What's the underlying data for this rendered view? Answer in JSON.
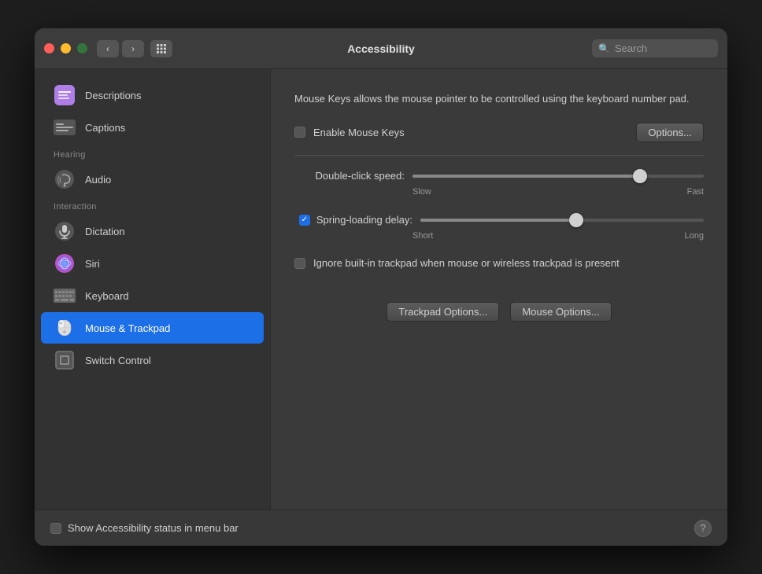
{
  "window": {
    "title": "Accessibility"
  },
  "titlebar": {
    "search_placeholder": "Search",
    "back_icon": "‹",
    "forward_icon": "›",
    "grid_icon": "⊞"
  },
  "sidebar": {
    "items_top": [
      {
        "id": "descriptions",
        "label": "Descriptions",
        "icon": "descriptions"
      },
      {
        "id": "captions",
        "label": "Captions",
        "icon": "captions"
      }
    ],
    "section_hearing": "Hearing",
    "items_hearing": [
      {
        "id": "audio",
        "label": "Audio",
        "icon": "audio"
      }
    ],
    "section_interaction": "Interaction",
    "items_interaction": [
      {
        "id": "dictation",
        "label": "Dictation",
        "icon": "dictation"
      },
      {
        "id": "siri",
        "label": "Siri",
        "icon": "siri"
      },
      {
        "id": "keyboard",
        "label": "Keyboard",
        "icon": "keyboard"
      },
      {
        "id": "mouse-trackpad",
        "label": "Mouse & Trackpad",
        "icon": "mouse",
        "active": true
      },
      {
        "id": "switch-control",
        "label": "Switch Control",
        "icon": "switch"
      }
    ]
  },
  "content": {
    "description": "Mouse Keys allows the mouse pointer to be controlled using the keyboard number pad.",
    "enable_mouse_keys_label": "Enable Mouse Keys",
    "options_button": "Options...",
    "double_click_label": "Double-click speed:",
    "double_click_slow": "Slow",
    "double_click_fast": "Fast",
    "double_click_value": 78,
    "spring_loading_label": "Spring-loading delay:",
    "spring_loading_short": "Short",
    "spring_loading_long": "Long",
    "spring_loading_value": 55,
    "spring_loading_checked": true,
    "ignore_trackpad_label": "Ignore built-in trackpad when mouse or wireless trackpad is present",
    "trackpad_options_button": "Trackpad Options...",
    "mouse_options_button": "Mouse Options..."
  },
  "bottom": {
    "show_status_label": "Show Accessibility status in menu bar",
    "help_icon": "?"
  }
}
